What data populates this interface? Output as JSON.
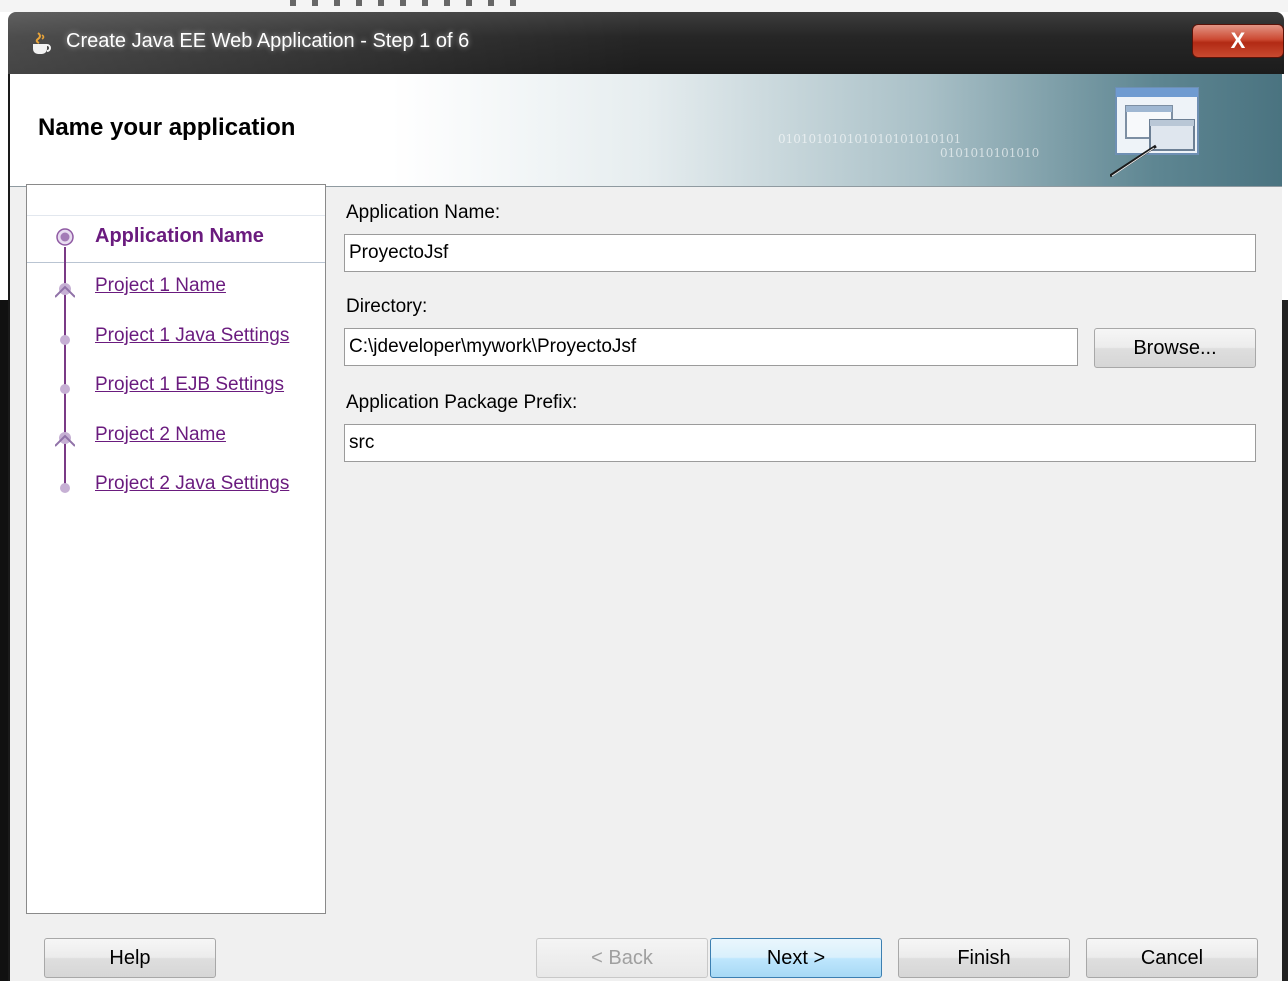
{
  "window": {
    "title": "Create Java EE Web Application - Step 1 of 6",
    "close_label": "X"
  },
  "banner": {
    "title": "Name your application",
    "binary_text_1": "010101010101010101010101",
    "binary_text_2": "0101010101010"
  },
  "steps": [
    {
      "label": "Application Name",
      "active": true
    },
    {
      "label": "Project 1 Name",
      "active": false
    },
    {
      "label": "Project 1 Java Settings",
      "active": false
    },
    {
      "label": "Project 1 EJB Settings",
      "active": false
    },
    {
      "label": "Project 2 Name",
      "active": false
    },
    {
      "label": "Project 2 Java Settings",
      "active": false
    }
  ],
  "form": {
    "app_name_label": "Application Name:",
    "app_name_value": "ProyectoJsf",
    "directory_label": "Directory:",
    "directory_value": "C:\\jdeveloper\\mywork\\ProyectoJsf",
    "browse_label": "Browse...",
    "package_label": "Application Package Prefix:",
    "package_value": "src"
  },
  "buttons": {
    "help": "Help",
    "back": "< Back",
    "next": "Next >",
    "finish": "Finish",
    "cancel": "Cancel"
  },
  "colors": {
    "step_link": "#6a1b7e",
    "titlebar": "#262626",
    "close_button": "#c84a30",
    "dialog_bg": "#f0f0f0"
  }
}
